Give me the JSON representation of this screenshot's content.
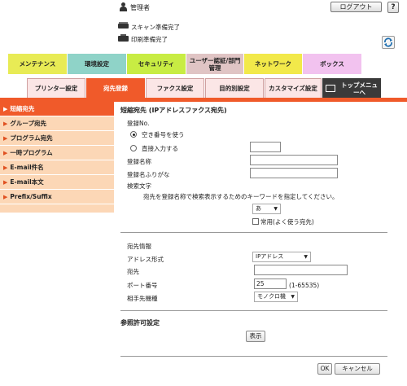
{
  "header": {
    "user_label": "管理者",
    "logout_label": "ログアウト",
    "help_label": "?",
    "status": [
      {
        "icon": "scanner-icon",
        "text": "スキャン準備完了"
      },
      {
        "icon": "printer-icon",
        "text": "印刷準備完了"
      }
    ],
    "refresh_icon": "refresh-icon"
  },
  "main_tabs": [
    {
      "label": "メンテナンス",
      "color": "#e8eb55"
    },
    {
      "label": "環境設定",
      "color": "#8fd3c8"
    },
    {
      "label": "セキュリティ",
      "color": "#c8ec43"
    },
    {
      "label": "ユーザー認証/部門管理",
      "color": "#e0c4c4"
    },
    {
      "label": "ネットワーク",
      "color": "#f2e94a"
    },
    {
      "label": "ボックス",
      "color": "#f2c2ef"
    }
  ],
  "sub_tabs": [
    {
      "label": "プリンター設定",
      "active": false
    },
    {
      "label": "宛先登録",
      "active": true
    },
    {
      "label": "ファクス設定",
      "active": false
    },
    {
      "label": "目的別設定",
      "active": false
    },
    {
      "label": "カスタマイズ設定",
      "active": false
    },
    {
      "label": "トップメニューへ",
      "dark": true
    }
  ],
  "sidebar": {
    "items": [
      {
        "label": "短縮宛先",
        "active": true
      },
      {
        "label": "グループ宛先",
        "active": false
      },
      {
        "label": "プログラム宛先",
        "active": false
      },
      {
        "label": "一時プログラム",
        "active": false
      },
      {
        "label": "E-mail件名",
        "active": false
      },
      {
        "label": "E-mail本文",
        "active": false
      },
      {
        "label": "Prefix/Suffix",
        "active": false
      }
    ]
  },
  "form": {
    "title": "短縮宛先 (IPアドレスファクス宛先)",
    "reg_no_label": "登録No.",
    "radio_auto_label": "空き番号を使う",
    "radio_manual_label": "直接入力する",
    "reg_name_label": "登録名称",
    "reg_furigana_label": "登録名ふりがな",
    "search_label": "検索文字",
    "search_desc": "宛先を登録名称で検索表示するためのキーワードを指定してください。",
    "search_select": "あ",
    "frequent_label": "常用(よく使う宛先)",
    "dest_info_label": "宛先情報",
    "addr_format_label": "アドレス形式",
    "addr_format_value": "IPアドレス",
    "dest_label": "宛先",
    "port_label": "ポート番号",
    "port_value": "25",
    "port_range": "(1-65535)",
    "device_label": "相手先機種",
    "device_value": "モノクロ機",
    "ref_section_label": "参照許可設定",
    "display_button": "表示",
    "ok_button": "OK",
    "cancel_button": "キャンセル"
  },
  "colors": {
    "accent": "#f05a2a",
    "sidebar_bg": "#fcd7b6",
    "subtab_bg": "#fbe6e6"
  }
}
